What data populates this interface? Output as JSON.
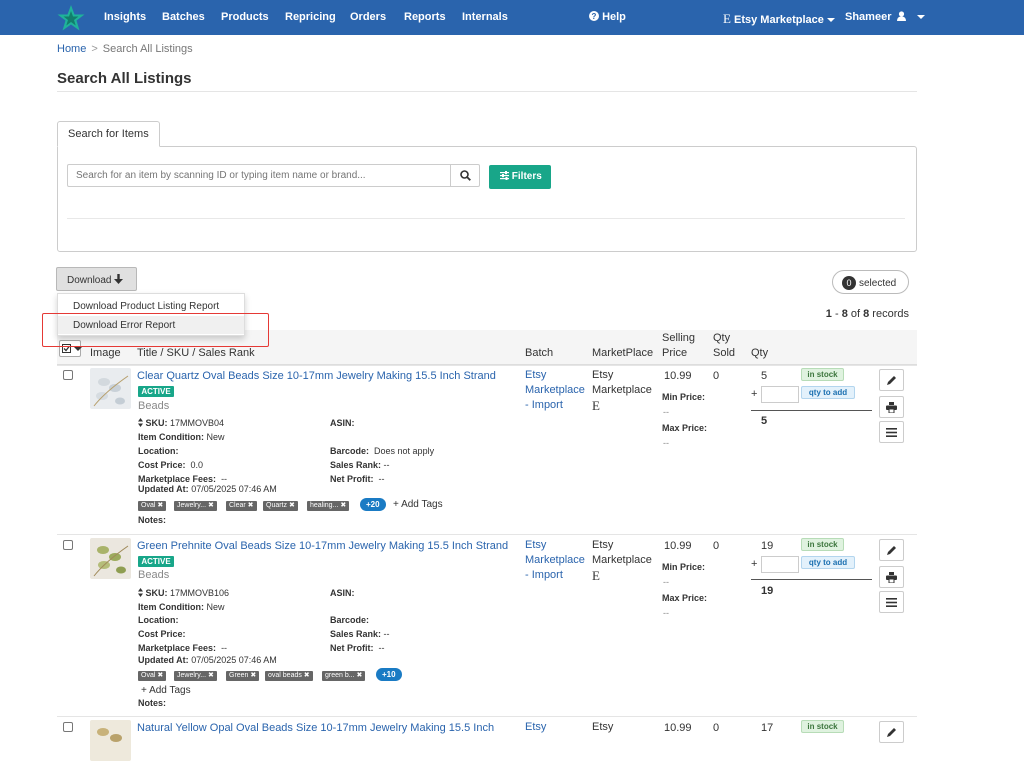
{
  "nav": {
    "items": [
      "Insights",
      "Batches",
      "Products",
      "Repricing",
      "Orders",
      "Reports",
      "Internals"
    ],
    "help": "Help",
    "marketplace": "Etsy Marketplace",
    "user": "Shameer",
    "brand_color": "#2a64ad"
  },
  "breadcrumb": {
    "home": "Home",
    "sep": ">",
    "current": "Search All Listings"
  },
  "page_title": "Search All Listings",
  "search": {
    "tab_label": "Search for Items",
    "placeholder": "Search for an item by scanning ID or typing item name or brand...",
    "filters_label": "Filters"
  },
  "download": {
    "button_label": "Download",
    "menu": [
      "Download Product Listing Report",
      "Download Error Report"
    ]
  },
  "selection": {
    "count": "0",
    "label": "selected"
  },
  "records": {
    "from": "1",
    "dash": " - ",
    "to": "8",
    "of_text": " of ",
    "total": "8",
    "suffix": " records"
  },
  "table": {
    "headers": {
      "image": "Image",
      "title": "Title / SKU / Sales Rank",
      "batch": "Batch",
      "marketplace": "MarketPlace",
      "selling_price_1": "Selling",
      "selling_price_2": "Price",
      "qty_sold_1": "Qty",
      "qty_sold_2": "Sold",
      "qty": "Qty"
    }
  },
  "labels": {
    "sku": "SKU:",
    "asin": "ASIN:",
    "item_condition": "Item Condition:",
    "location": "Location:",
    "barcode": "Barcode:",
    "cost_price": "Cost Price:",
    "sales_rank": "Sales Rank:",
    "marketplace_fees": "Marketplace Fees:",
    "net_profit": "Net Profit:",
    "updated_at": "Updated At:",
    "notes": "Notes:",
    "add_tags": "Add Tags",
    "min_price": "Min Price:",
    "max_price": "Max Price:",
    "in_stock": "in stock",
    "qty_to_add": "qty to add",
    "plus": "+",
    "active": "ACTIVE",
    "dashdash": "--"
  },
  "rows": [
    {
      "title": "Clear Quartz Oval Beads Size 10-17mm Jewelry Making 15.5 Inch Strand",
      "category": "Beads",
      "sku": "17MMOVB04",
      "item_condition": "New",
      "barcode": "Does not apply",
      "cost_price": "0.0",
      "sales_rank": "--",
      "marketplace_fees": "--",
      "net_profit": "--",
      "updated_at": "07/05/2025 07:46 AM",
      "tags": [
        "Oval",
        "Jewelry...",
        "Clear",
        "Quartz",
        "healing..."
      ],
      "more_tags": "+20",
      "batch": [
        "Etsy",
        "Marketplace",
        "- Import"
      ],
      "marketplace": [
        "Etsy",
        "Marketplace"
      ],
      "selling_price": "10.99",
      "qty_sold": "0",
      "qty": "5",
      "qty_total": "5"
    },
    {
      "title": "Green Prehnite Oval Beads Size 10-17mm Jewelry Making 15.5 Inch Strand",
      "category": "Beads",
      "sku": "17MMOVB106",
      "item_condition": "New",
      "barcode": "",
      "cost_price": "",
      "sales_rank": "--",
      "marketplace_fees": "--",
      "net_profit": "--",
      "updated_at": "07/05/2025 07:46 AM",
      "tags": [
        "Oval",
        "Jewelry...",
        "Green",
        "oval beads",
        "green b..."
      ],
      "more_tags": "+10",
      "batch": [
        "Etsy",
        "Marketplace",
        "- Import"
      ],
      "marketplace": [
        "Etsy",
        "Marketplace"
      ],
      "selling_price": "10.99",
      "qty_sold": "0",
      "qty": "19",
      "qty_total": "19"
    },
    {
      "title": "Natural Yellow Opal Oval Beads Size 10-17mm Jewelry Making 15.5 Inch",
      "batch": [
        "Etsy"
      ],
      "marketplace": [
        "Etsy"
      ],
      "selling_price": "10.99",
      "qty_sold": "0",
      "qty": "17"
    }
  ]
}
